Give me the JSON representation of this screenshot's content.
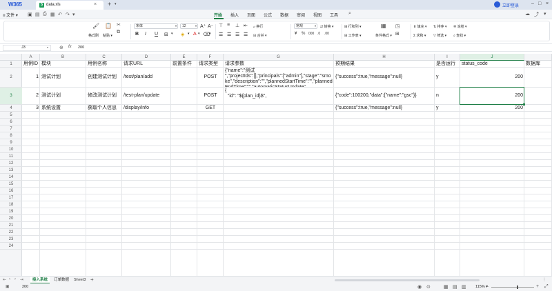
{
  "titlebar": {
    "logo": "W365",
    "tab_icon": "S",
    "file_name": "data.xls",
    "close": "×",
    "new_tab": "+",
    "login": "立即登录"
  },
  "menubar": {
    "file": "文件",
    "tabs": [
      {
        "label": "开始",
        "active": true
      },
      {
        "label": "插入"
      },
      {
        "label": "页面"
      },
      {
        "label": "公式"
      },
      {
        "label": "数据"
      },
      {
        "label": "审阅"
      },
      {
        "label": "视图"
      },
      {
        "label": "工具"
      }
    ]
  },
  "ribbon": {
    "format_painter": "格式刷",
    "paste": "粘贴",
    "font_name": "宋体",
    "font_size": "12",
    "wrap": "换行",
    "merge": "合并",
    "number_format": "常规",
    "convert": "转换",
    "row_col": "行和列",
    "worksheet": "工作表",
    "cond_format": "条件格式",
    "fill": "填充",
    "sum": "求和",
    "sort": "排序",
    "filter": "筛选",
    "freeze": "冻结",
    "find": "查找"
  },
  "formulabar": {
    "cell_ref": "J3",
    "fx": "fx",
    "value": "200"
  },
  "columns": [
    "A",
    "B",
    "C",
    "D",
    "E",
    "F",
    "G",
    "H",
    "I",
    "J"
  ],
  "selected_column": "J",
  "rows": [
    "1",
    "2",
    "3",
    "4",
    "5",
    "6",
    "7",
    "8",
    "9",
    "10",
    "11",
    "12",
    "13",
    "14",
    "15",
    "16",
    "17",
    "18",
    "19",
    "20",
    "21",
    "22",
    "23",
    "24"
  ],
  "selected_row": "3",
  "table": {
    "header": {
      "a": "用例ID",
      "b": "模块",
      "c": "用例名称",
      "d": "请求URL",
      "e": "前置条件",
      "f": "请求类型",
      "g": "请求参数",
      "h": "预期结果",
      "i": "是否运行",
      "j": "status_code",
      "k": "数据库"
    },
    "rows": [
      {
        "a": "1",
        "b": "测试计划",
        "c": "创建测试计划",
        "d": "/test/plan/add",
        "e": "",
        "f": "POST",
        "g": "{\"name\":\"测试\n\",\"projectIds\":[],\"principals\":[\"admin\"],\"stage\":\"smoke\",\"description\":\"\",\"plannedStartTime\":\"\",\"plannedEndTime\":\"\",\"automaticStatusUpdate\"",
        "h": "{\"success\":true,\"message\":null}",
        "i": "y",
        "j": "200"
      },
      {
        "a": "2",
        "b": "测试计划",
        "c": "修改测试计划",
        "d": "/test-plan/update",
        "e": "",
        "f": "POST",
        "g": "{\n  \"id\": \"${plan_id}$\",",
        "h": "{\"code\":100200,\"data\":{\"name\":\"gsc\"}}",
        "i": "n",
        "j": "200"
      },
      {
        "a": "3",
        "b": "系统设置",
        "c": "获取个人信息",
        "d": "/display/info",
        "e": "",
        "f": "GET",
        "g": "",
        "h": "{\"success\":true,\"message\":null}",
        "i": "y",
        "j": "200"
      }
    ]
  },
  "sheets": [
    {
      "label": "接入系统",
      "active": true
    },
    {
      "label": "订单数据"
    },
    {
      "label": "Sheet3"
    }
  ],
  "add_sheet": "+",
  "status": {
    "sum": "200",
    "zoom": "115%"
  }
}
